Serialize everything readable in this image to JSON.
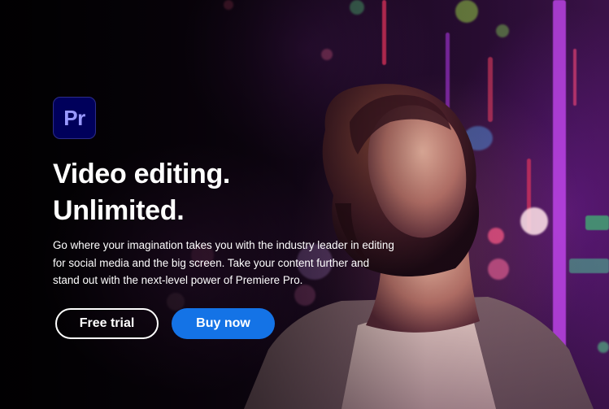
{
  "hero": {
    "app_logo_text": "Pr",
    "headline_line1": "Video editing.",
    "headline_line2": "Unlimited.",
    "description": "Go where your imagination takes you with the industry leader in editing for social media and the big screen. Take your content further and stand out with the next-level power of Premiere Pro.",
    "free_trial_label": "Free trial",
    "buy_now_label": "Buy now",
    "background_image": "person-looking-up-city-lights",
    "colors": {
      "logo_bg": "#00005b",
      "logo_text": "#9999ff",
      "primary_button": "#1473e6",
      "text": "#ffffff"
    }
  }
}
